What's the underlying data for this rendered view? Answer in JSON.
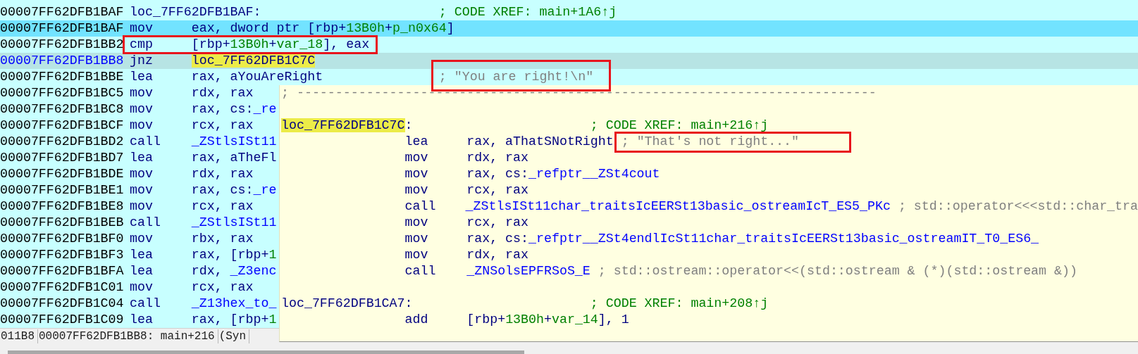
{
  "listing": {
    "rows": [
      {
        "address": "00007FF62DFB1BAF",
        "selected": false,
        "highlighted": false,
        "kind": "label",
        "label": [
          {
            "text": "loc_7FF62DFB1BAF:",
            "kind": "plain"
          }
        ],
        "comment": {
          "text": "; CODE XREF: main+1A6↑j",
          "kind": "xref"
        }
      },
      {
        "address": "00007FF62DFB1BAF",
        "selected": false,
        "highlighted": true,
        "kind": "instruction",
        "mnemonic": "mov",
        "operand": [
          {
            "text": "eax, dword ptr [rbp+",
            "kind": "plain"
          },
          {
            "text": "13B0h",
            "kind": "num"
          },
          {
            "text": "+",
            "kind": "plain"
          },
          {
            "text": "p_n0x64",
            "kind": "var"
          },
          {
            "text": "]",
            "kind": "plain"
          }
        ]
      },
      {
        "address": "00007FF62DFB1BB2",
        "selected": false,
        "highlighted": false,
        "kind": "instruction",
        "mnemonic": "cmp",
        "operand": [
          {
            "text": "[rbp+",
            "kind": "plain"
          },
          {
            "text": "13B0h",
            "kind": "num"
          },
          {
            "text": "+",
            "kind": "plain"
          },
          {
            "text": "var_18",
            "kind": "var"
          },
          {
            "text": "], eax",
            "kind": "plain"
          }
        ]
      },
      {
        "address": "00007FF62DFB1BB8",
        "selected": true,
        "highlighted": false,
        "kind": "instruction",
        "mnemonic": "jnz",
        "operand": [
          {
            "text": "loc_7FF62DFB1C7C",
            "kind": "match"
          }
        ]
      },
      {
        "address": "00007FF62DFB1BBE",
        "selected": false,
        "highlighted": false,
        "kind": "instruction",
        "mnemonic": "lea",
        "operand": [
          {
            "text": "rax, aYouAreRight",
            "kind": "plain"
          }
        ],
        "comment": {
          "text": "; \"You are right!\\n\"",
          "kind": "string"
        }
      },
      {
        "address": "00007FF62DFB1BC5",
        "selected": false,
        "highlighted": false,
        "kind": "instruction",
        "mnemonic": "mov",
        "operand": [
          {
            "text": "rdx, rax",
            "kind": "plain"
          }
        ]
      },
      {
        "address": "00007FF62DFB1BC8",
        "selected": false,
        "highlighted": false,
        "kind": "instruction",
        "mnemonic": "mov",
        "operand": [
          {
            "text": "rax, cs:",
            "kind": "plain"
          },
          {
            "text": "_re",
            "kind": "name"
          }
        ]
      },
      {
        "address": "00007FF62DFB1BCF",
        "selected": false,
        "highlighted": false,
        "kind": "instruction",
        "mnemonic": "mov",
        "operand": [
          {
            "text": "rcx, rax",
            "kind": "plain"
          }
        ]
      },
      {
        "address": "00007FF62DFB1BD2",
        "selected": false,
        "highlighted": false,
        "kind": "instruction",
        "mnemonic": "call",
        "operand": [
          {
            "text": "_ZStlsISt11",
            "kind": "name"
          }
        ]
      },
      {
        "address": "00007FF62DFB1BD7",
        "selected": false,
        "highlighted": false,
        "kind": "instruction",
        "mnemonic": "lea",
        "operand": [
          {
            "text": "rax, aTheFl",
            "kind": "plain"
          }
        ]
      },
      {
        "address": "00007FF62DFB1BDE",
        "selected": false,
        "highlighted": false,
        "kind": "instruction",
        "mnemonic": "mov",
        "operand": [
          {
            "text": "rdx, rax",
            "kind": "plain"
          }
        ]
      },
      {
        "address": "00007FF62DFB1BE1",
        "selected": false,
        "highlighted": false,
        "kind": "instruction",
        "mnemonic": "mov",
        "operand": [
          {
            "text": "rax, cs:",
            "kind": "plain"
          },
          {
            "text": "_re",
            "kind": "name"
          }
        ]
      },
      {
        "address": "00007FF62DFB1BE8",
        "selected": false,
        "highlighted": false,
        "kind": "instruction",
        "mnemonic": "mov",
        "operand": [
          {
            "text": "rcx, rax",
            "kind": "plain"
          }
        ]
      },
      {
        "address": "00007FF62DFB1BEB",
        "selected": false,
        "highlighted": false,
        "kind": "instruction",
        "mnemonic": "call",
        "operand": [
          {
            "text": "_ZStlsISt11",
            "kind": "name"
          }
        ]
      },
      {
        "address": "00007FF62DFB1BF0",
        "selected": false,
        "highlighted": false,
        "kind": "instruction",
        "mnemonic": "mov",
        "operand": [
          {
            "text": "rbx, rax",
            "kind": "plain"
          }
        ]
      },
      {
        "address": "00007FF62DFB1BF3",
        "selected": false,
        "highlighted": false,
        "kind": "instruction",
        "mnemonic": "lea",
        "operand": [
          {
            "text": "rax, [rbp+",
            "kind": "plain"
          },
          {
            "text": "1",
            "kind": "num"
          }
        ]
      },
      {
        "address": "00007FF62DFB1BFA",
        "selected": false,
        "highlighted": false,
        "kind": "instruction",
        "mnemonic": "lea",
        "operand": [
          {
            "text": "rdx, ",
            "kind": "plain"
          },
          {
            "text": "_Z3enc",
            "kind": "name"
          }
        ]
      },
      {
        "address": "00007FF62DFB1C01",
        "selected": false,
        "highlighted": false,
        "kind": "instruction",
        "mnemonic": "mov",
        "operand": [
          {
            "text": "rcx, rax",
            "kind": "plain"
          }
        ]
      },
      {
        "address": "00007FF62DFB1C04",
        "selected": false,
        "highlighted": false,
        "kind": "instruction",
        "mnemonic": "call",
        "operand": [
          {
            "text": "_Z13hex_to_",
            "kind": "name"
          }
        ]
      },
      {
        "address": "00007FF62DFB1C09",
        "selected": false,
        "highlighted": false,
        "kind": "instruction",
        "mnemonic": "lea",
        "operand": [
          {
            "text": "rax, [rbp+",
            "kind": "plain"
          },
          {
            "text": "1",
            "kind": "num"
          }
        ]
      }
    ]
  },
  "hint_popup": {
    "lines": [
      {
        "kind": "separator",
        "text": "; ---------------------------------------------------------------------------"
      },
      {
        "kind": "blank"
      },
      {
        "kind": "label",
        "label": [
          {
            "text": "loc_7FF62DFB1C7C",
            "kind": "match"
          },
          {
            "text": ":",
            "kind": "plain"
          }
        ],
        "comment": {
          "text": "; CODE XREF: main+216↑j",
          "kind": "xref"
        }
      },
      {
        "kind": "instruction",
        "mnemonic": "lea",
        "operand": [
          {
            "text": "rax, aThatSNotRight",
            "kind": "plain"
          }
        ],
        "comment": {
          "text": "; \"That's not right...\"",
          "kind": "string"
        }
      },
      {
        "kind": "instruction",
        "mnemonic": "mov",
        "operand": [
          {
            "text": "rdx, rax",
            "kind": "plain"
          }
        ]
      },
      {
        "kind": "instruction",
        "mnemonic": "mov",
        "operand": [
          {
            "text": "rax, cs:",
            "kind": "plain"
          },
          {
            "text": "_refptr__ZSt4cout",
            "kind": "name"
          }
        ]
      },
      {
        "kind": "instruction",
        "mnemonic": "mov",
        "operand": [
          {
            "text": "rcx, rax",
            "kind": "plain"
          }
        ]
      },
      {
        "kind": "instruction",
        "mnemonic": "call",
        "operand": [
          {
            "text": "_ZStlsISt11char_traitsIcEERSt13basic_ostreamIcT_ES5_PKc",
            "kind": "name"
          }
        ],
        "comment": {
          "text": "; std::operator<<<std::char_tra",
          "kind": "string"
        }
      },
      {
        "kind": "instruction",
        "mnemonic": "mov",
        "operand": [
          {
            "text": "rcx, rax",
            "kind": "plain"
          }
        ]
      },
      {
        "kind": "instruction",
        "mnemonic": "mov",
        "operand": [
          {
            "text": "rax, cs:",
            "kind": "plain"
          },
          {
            "text": "_refptr__ZSt4endlIcSt11char_traitsIcEERSt13basic_ostreamIT_T0_ES6_",
            "kind": "name"
          }
        ]
      },
      {
        "kind": "instruction",
        "mnemonic": "mov",
        "operand": [
          {
            "text": "rdx, rax",
            "kind": "plain"
          }
        ]
      },
      {
        "kind": "instruction",
        "mnemonic": "call",
        "operand": [
          {
            "text": "_ZNSolsEPFRSoS_E",
            "kind": "name"
          }
        ],
        "comment": {
          "text": "; std::ostream::operator<<(std::ostream & (*)(std::ostream &))",
          "kind": "string"
        }
      },
      {
        "kind": "blank"
      },
      {
        "kind": "label",
        "label": [
          {
            "text": "loc_7FF62DFB1CA7",
            "kind": "plain"
          },
          {
            "text": ":",
            "kind": "plain"
          }
        ],
        "comment": {
          "text": "; CODE XREF: main+208↑j",
          "kind": "xref"
        }
      },
      {
        "kind": "instruction",
        "mnemonic": "add",
        "operand": [
          {
            "text": "[rbp+",
            "kind": "plain"
          },
          {
            "text": "13B0h",
            "kind": "num"
          },
          {
            "text": "+",
            "kind": "plain"
          },
          {
            "text": "var_14",
            "kind": "var"
          },
          {
            "text": "], 1",
            "kind": "plain"
          }
        ]
      }
    ]
  },
  "status_bar": {
    "sections": [
      "011B8",
      "00007FF62DFB1BB8: main+216",
      "(Syn"
    ]
  }
}
